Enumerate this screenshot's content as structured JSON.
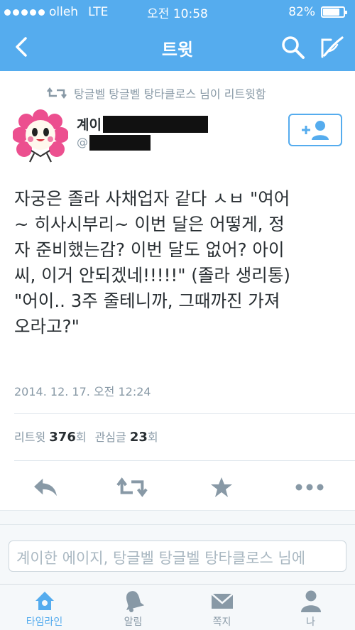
{
  "status_bar": {
    "carrier": "olleh",
    "network": "LTE",
    "time": "오전 10:58",
    "battery": "82%",
    "battery_level": 0.82
  },
  "nav": {
    "title": "트윗"
  },
  "retweet_context": "탕글벨 탕글벨 탕타클로스 님이 리트윗함",
  "author": {
    "name_visible": "계이",
    "handle_prefix": "@"
  },
  "tweet": {
    "text": "자궁은 졸라 사채업자 같다 ㅅㅂ \"여어\n~ 히사시부리~ 이번 달은 어떻게, 정\n자 준비했는감? 이번 달도 없어? 아이\n씨, 이거 안되겠네!!!!!\" (졸라 생리통)\n\"어이.. 3주 줄테니까, 그때까진 가져\n오라고?\"",
    "timestamp": "2014. 12. 17. 오전 12:24"
  },
  "stats": {
    "retweet_label": "리트윗",
    "retweet_count": "376",
    "retweet_unit": "회",
    "favorite_label": "관심글",
    "favorite_count": "23",
    "favorite_unit": "회"
  },
  "reply": {
    "placeholder": "계이한 에이지, 탕글벨 탕글벨 탕타클로스 님에"
  },
  "tabs": [
    {
      "label": "타임라인",
      "icon": "home-icon",
      "active": true
    },
    {
      "label": "알림",
      "icon": "bell-icon",
      "active": false
    },
    {
      "label": "쪽지",
      "icon": "envelope-icon",
      "active": false
    },
    {
      "label": "나",
      "icon": "person-icon",
      "active": false
    }
  ],
  "colors": {
    "brand": "#55acee",
    "text": "#292f33",
    "muted": "#8899a6",
    "action_icon": "#8899a6"
  }
}
